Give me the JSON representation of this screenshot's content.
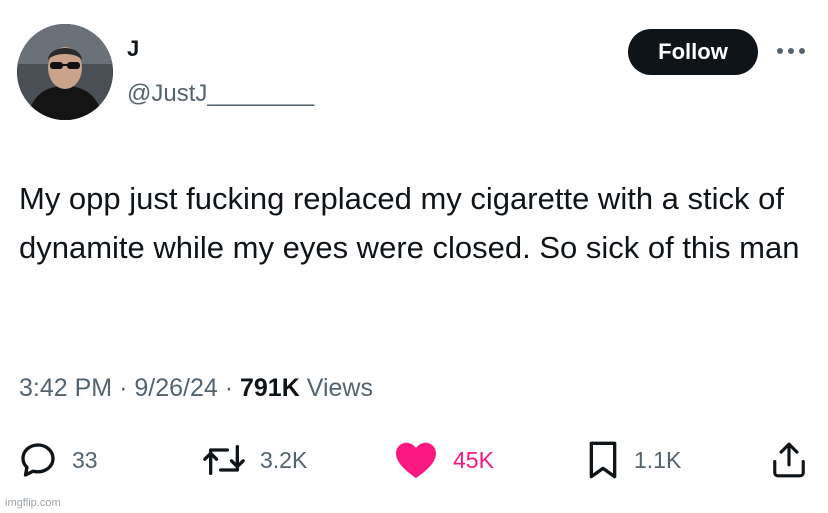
{
  "author": {
    "display_name": "J",
    "handle": "@JustJ________"
  },
  "follow_button": {
    "label": "Follow"
  },
  "tweet": {
    "text": "My opp just fucking replaced my cigarette with a stick of dynamite while my eyes were closed. So sick of this man"
  },
  "meta": {
    "time": "3:42 PM",
    "separator": "·",
    "date": "9/26/24",
    "views_count": "791K",
    "views_label": "Views"
  },
  "actions": {
    "replies": "33",
    "reposts": "3.2K",
    "likes": "45K",
    "bookmarks": "1.1K"
  },
  "colors": {
    "like": "#f91880",
    "secondary_text": "#536471",
    "primary_text": "#0f1419"
  },
  "watermark": "imgflip.com"
}
